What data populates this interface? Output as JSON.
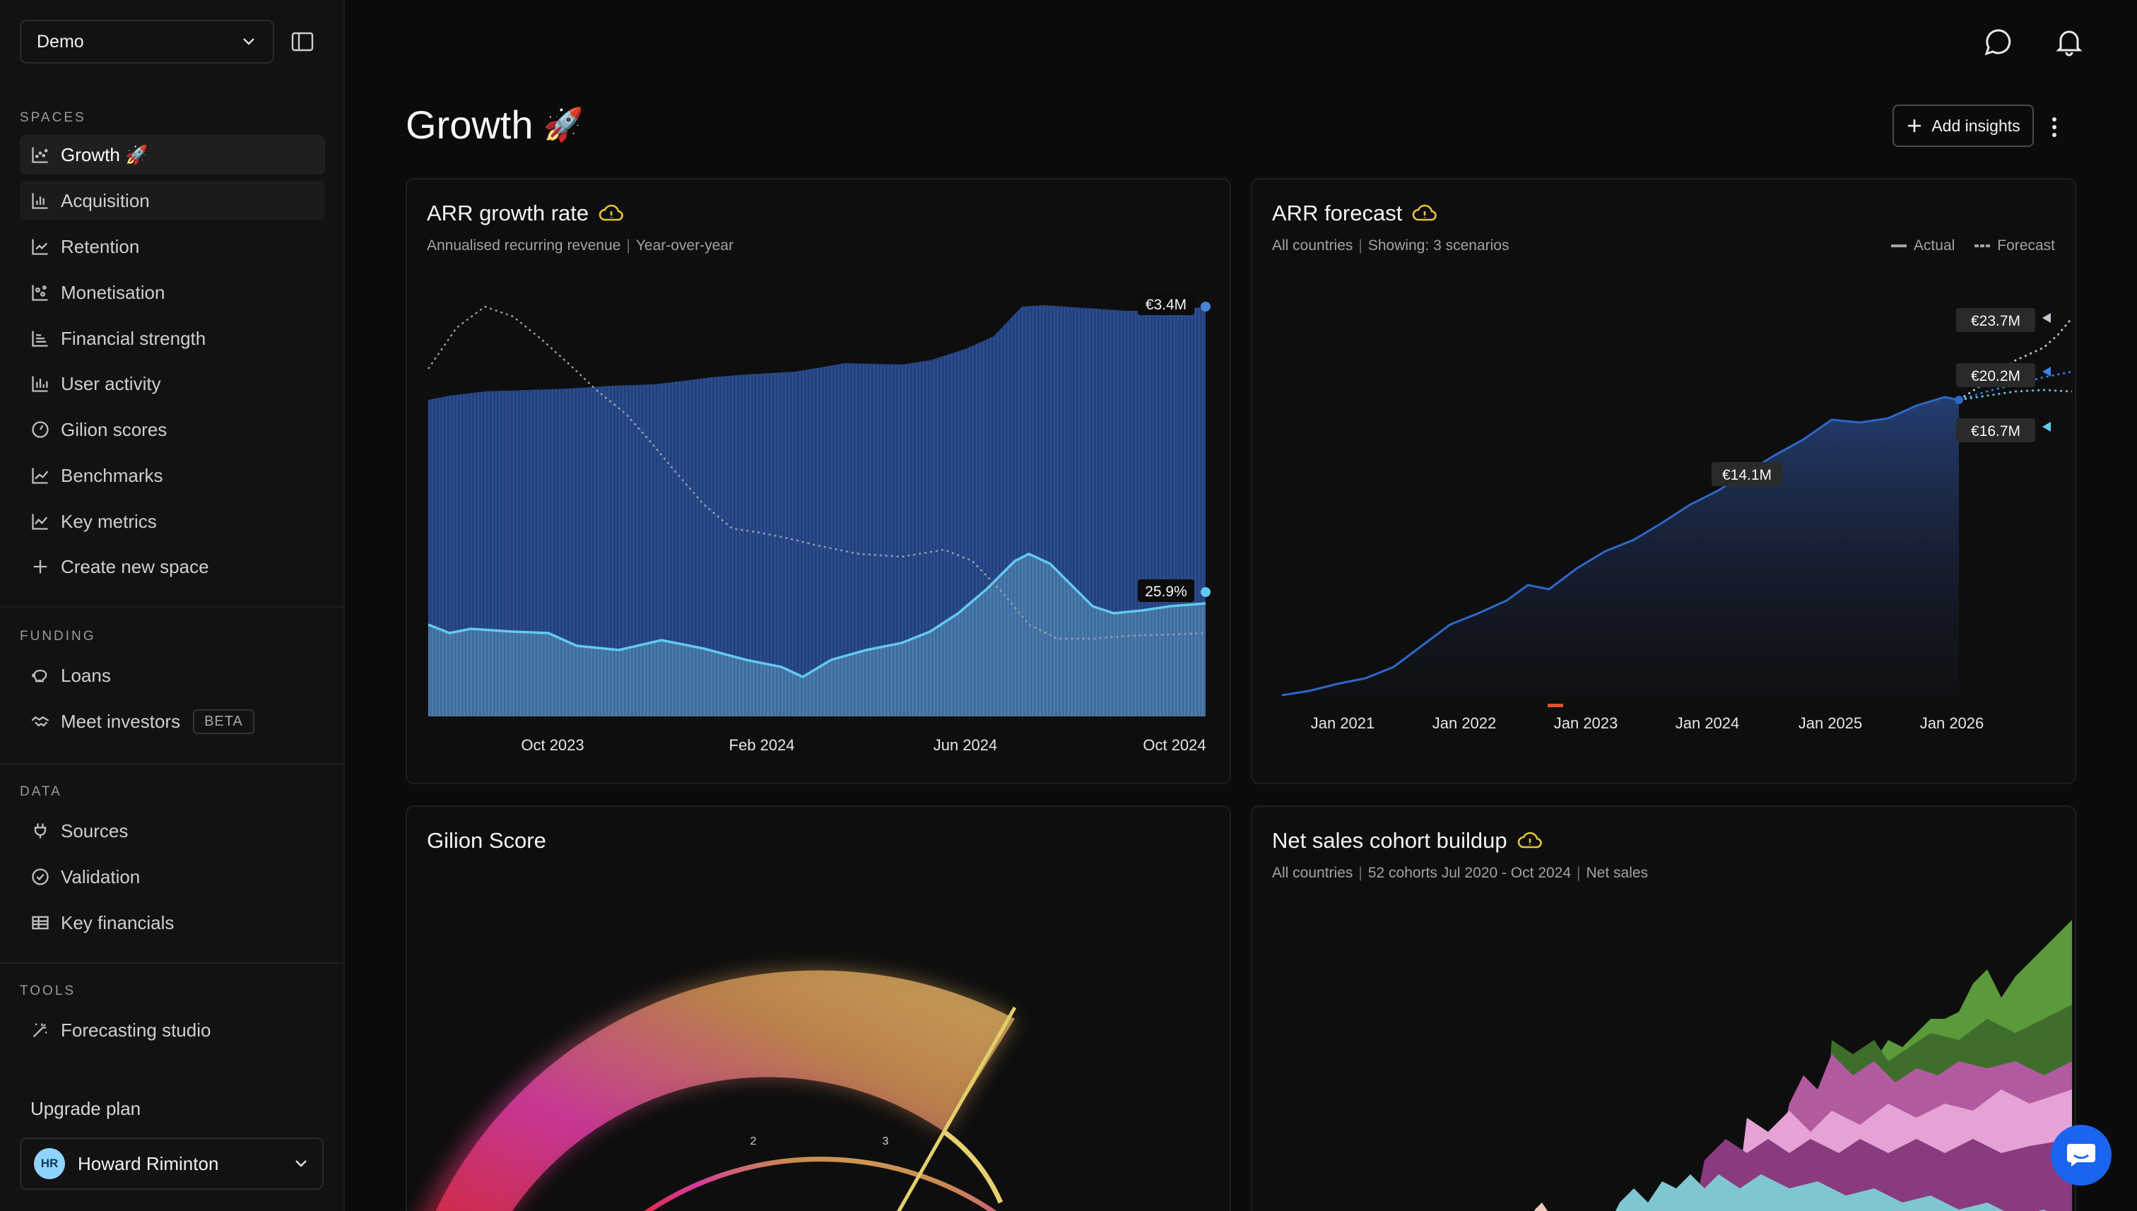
{
  "workspace": {
    "name": "Demo"
  },
  "sidebar": {
    "spaces_label": "SPACES",
    "spaces": [
      {
        "label": "Growth 🚀",
        "icon": "scatter-chart-icon"
      },
      {
        "label": "Acquisition",
        "icon": "bar-chart-icon"
      },
      {
        "label": "Retention",
        "icon": "trend-line-icon"
      },
      {
        "label": "Monetisation",
        "icon": "dots-chart-icon"
      },
      {
        "label": "Financial strength",
        "icon": "stack-chart-icon"
      },
      {
        "label": "User activity",
        "icon": "column-chart-icon"
      },
      {
        "label": "Gilion scores",
        "icon": "gauge-icon"
      },
      {
        "label": "Benchmarks",
        "icon": "line-chart-icon"
      },
      {
        "label": "Key metrics",
        "icon": "line-chart-icon"
      },
      {
        "label": "Create new space",
        "icon": "plus-icon"
      }
    ],
    "funding_label": "FUNDING",
    "funding": [
      {
        "label": "Loans",
        "icon": "piggy-bank-icon"
      },
      {
        "label": "Meet investors",
        "icon": "handshake-icon",
        "badge": "BETA"
      }
    ],
    "data_label": "DATA",
    "data": [
      {
        "label": "Sources",
        "icon": "plug-icon"
      },
      {
        "label": "Validation",
        "icon": "check-circle-icon"
      },
      {
        "label": "Key financials",
        "icon": "table-icon"
      }
    ],
    "tools_label": "TOOLS",
    "tools": [
      {
        "label": "Forecasting studio",
        "icon": "magic-wand-icon"
      }
    ],
    "upgrade": "Upgrade plan",
    "user": {
      "initials": "HR",
      "name": "Howard Riminton"
    }
  },
  "header": {
    "title": "Growth",
    "title_emoji": "🚀",
    "add_label": "Add insights"
  },
  "cards": {
    "arr_growth": {
      "title": "ARR growth rate",
      "sub1": "Annualised recurring revenue",
      "sub2": "Year-over-year",
      "bar_label": "€3.4M",
      "line_label": "25.9%"
    },
    "arr_forecast": {
      "title": "ARR forecast",
      "sub1": "All countries",
      "sub2": "Showing: 3 scenarios",
      "legend_actual": "Actual",
      "legend_forecast": "Forecast",
      "actual_label": "€14.1M",
      "scenario_labels": [
        "€23.7M",
        "€20.2M",
        "€16.7M"
      ]
    },
    "gilion_score": {
      "title": "Gilion Score",
      "ticks": [
        "2",
        "3"
      ]
    },
    "cohort": {
      "title": "Net sales cohort buildup",
      "sub1": "All countries",
      "sub2": "52 cohorts Jul 2020 - Oct 2024",
      "sub3": "Net sales"
    }
  },
  "chart_data": [
    {
      "type": "bar",
      "title": "ARR growth rate",
      "x_ticks": [
        "Oct 2023",
        "Feb 2024",
        "Jun 2024",
        "Oct 2024"
      ],
      "series": [
        {
          "name": "ARR",
          "unit": "€M",
          "values": [
            2.65,
            2.66,
            2.7,
            2.72,
            2.75,
            2.8,
            2.85,
            2.9,
            3.0,
            3.25,
            3.35,
            3.38,
            3.4
          ]
        },
        {
          "name": "Growth rate",
          "unit": "%",
          "values": [
            30,
            29.5,
            28.5,
            27.5,
            26.5,
            24,
            23,
            24,
            27,
            32,
            37,
            27,
            25.9
          ]
        }
      ]
    },
    {
      "type": "area",
      "title": "ARR forecast",
      "x_ticks": [
        "Jan 2021",
        "Jan 2022",
        "Jan 2023",
        "Jan 2024",
        "Jan 2025",
        "Jan 2026"
      ],
      "actual_last": "€14.1M",
      "scenarios": [
        "€23.7M",
        "€20.2M",
        "€16.7M"
      ]
    }
  ],
  "colors": {
    "accent": "#5ac8ee",
    "bar": "#2a4a8a",
    "warning": "#e8c33a",
    "fab": "#1a64f0"
  }
}
